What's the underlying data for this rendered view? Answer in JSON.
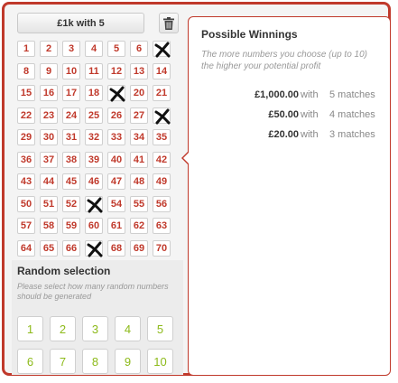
{
  "ticket_label": "£1k with 5",
  "numbers": [
    1,
    2,
    3,
    4,
    5,
    6,
    7,
    8,
    9,
    10,
    11,
    12,
    13,
    14,
    15,
    16,
    17,
    18,
    19,
    20,
    21,
    22,
    23,
    24,
    25,
    26,
    27,
    28,
    29,
    30,
    31,
    32,
    33,
    34,
    35,
    36,
    37,
    38,
    39,
    40,
    41,
    42,
    43,
    44,
    45,
    46,
    47,
    48,
    49,
    50,
    51,
    52,
    53,
    54,
    55,
    56,
    57,
    58,
    59,
    60,
    61,
    62,
    63,
    64,
    65,
    66,
    67,
    68,
    69,
    70
  ],
  "picked": [
    7,
    19,
    28,
    53,
    67
  ],
  "random": {
    "title": "Random selection",
    "hint": "Please select how many random numbers should be generated",
    "options": [
      "1",
      "2",
      "3",
      "4",
      "5",
      "6",
      "7",
      "8",
      "9",
      "10"
    ]
  },
  "winnings": {
    "title": "Possible Winnings",
    "description": "The more numbers you choose (up to 10) the higher your potential profit",
    "rows": [
      {
        "amount": "£1,000.00",
        "with": "with",
        "matches": "5 matches"
      },
      {
        "amount": "£50.00",
        "with": "with",
        "matches": "4 matches"
      },
      {
        "amount": "£20.00",
        "with": "with",
        "matches": "3 matches"
      }
    ]
  },
  "colors": {
    "accent": "#c0392b",
    "random_number": "#8dba1a"
  },
  "icons": {
    "trash": "trash-icon",
    "pick_mark": "cross-mark-icon"
  }
}
